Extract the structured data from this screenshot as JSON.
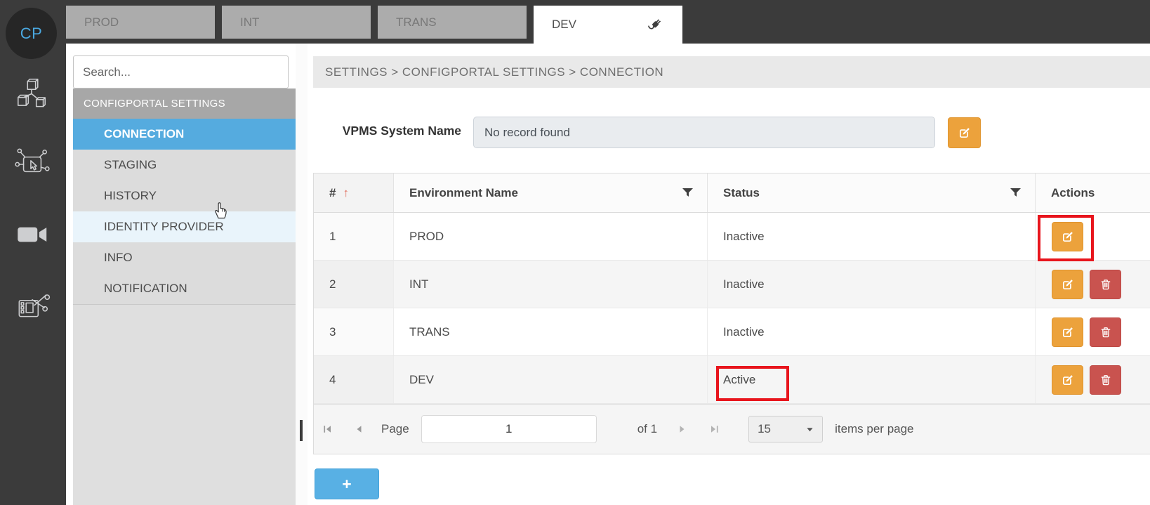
{
  "rail": {
    "avatar": "CP",
    "icons": [
      "modules-icon",
      "app-interaction-icon",
      "video-camera-icon",
      "video-edit-icon"
    ]
  },
  "tabs": [
    {
      "label": "PROD",
      "active": false
    },
    {
      "label": "INT",
      "active": false
    },
    {
      "label": "TRANS",
      "active": false
    },
    {
      "label": "DEV",
      "active": true,
      "icon": "plug-icon"
    }
  ],
  "sidebar": {
    "search_placeholder": "Search...",
    "section_header": "CONFIGPORTAL SETTINGS",
    "items": [
      {
        "label": "CONNECTION",
        "state": "selected"
      },
      {
        "label": "STAGING",
        "state": "normal"
      },
      {
        "label": "HISTORY",
        "state": "normal"
      },
      {
        "label": "IDENTITY PROVIDER",
        "state": "hover"
      },
      {
        "label": "INFO",
        "state": "normal"
      },
      {
        "label": "NOTIFICATION",
        "state": "normal"
      }
    ]
  },
  "breadcrumb": "SETTINGS > CONFIGPORTAL SETTINGS > CONNECTION",
  "form": {
    "label": "VPMS System Name",
    "value": "No record found",
    "edit_button_icon": "edit-icon"
  },
  "grid": {
    "columns": {
      "num": "#",
      "environment": "Environment Name",
      "status": "Status",
      "actions": "Actions"
    },
    "sort_icon": "↑",
    "rows": [
      {
        "num": "1",
        "environment": "PROD",
        "status": "Inactive"
      },
      {
        "num": "2",
        "environment": "INT",
        "status": "Inactive"
      },
      {
        "num": "3",
        "environment": "TRANS",
        "status": "Inactive"
      },
      {
        "num": "4",
        "environment": "DEV",
        "status": "Active"
      }
    ],
    "pager": {
      "page_label": "Page",
      "page_value": "1",
      "of_label": "of 1",
      "page_size": "15",
      "items_per_page_label": "items per page"
    }
  },
  "add_button_label": "+",
  "annotations": [
    {
      "name": "highlight-row1-edit-button",
      "color": "#e8151d"
    },
    {
      "name": "highlight-dev-active-status",
      "color": "#e8151d"
    }
  ],
  "colors": {
    "topbar": "#3b3b3b",
    "selected_blue": "#55abdf",
    "add_blue": "#58b0e4",
    "edit_orange": "#eca23c",
    "delete_red": "#c9534f",
    "annotation_red": "#e8151d"
  }
}
